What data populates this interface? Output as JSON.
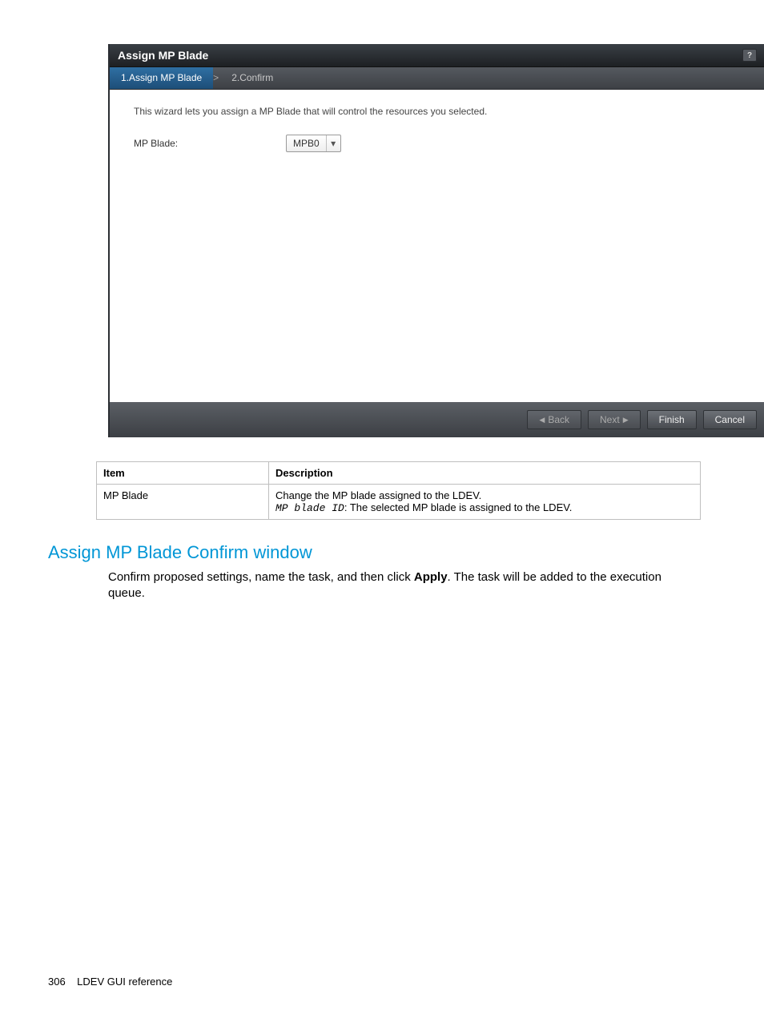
{
  "wizard": {
    "title": "Assign MP Blade",
    "steps": [
      "1.Assign MP Blade",
      "2.Confirm"
    ],
    "active_step_index": 0,
    "instruction": "This wizard lets you assign a MP Blade that will control the resources you selected.",
    "field_label": "MP Blade:",
    "select_value": "MPB0",
    "buttons": {
      "back": "Back",
      "next": "Next",
      "finish": "Finish",
      "cancel": "Cancel"
    },
    "titlebar_icon_name": "help-icon"
  },
  "table": {
    "headers": [
      "Item",
      "Description"
    ],
    "rows": [
      {
        "item": "MP Blade",
        "desc_line1": "Change the MP blade assigned to the LDEV.",
        "desc_mono": "MP blade ID",
        "desc_line2_rest": ": The selected MP blade is assigned to the LDEV."
      }
    ]
  },
  "section": {
    "heading": "Assign MP Blade Confirm window",
    "para_before_bold": "Confirm proposed settings, name the task, and then click ",
    "para_bold": "Apply",
    "para_after_bold": ". The task will be added to the execution queue."
  },
  "footer": {
    "page_number": "306",
    "chapter": "LDEV GUI reference"
  }
}
